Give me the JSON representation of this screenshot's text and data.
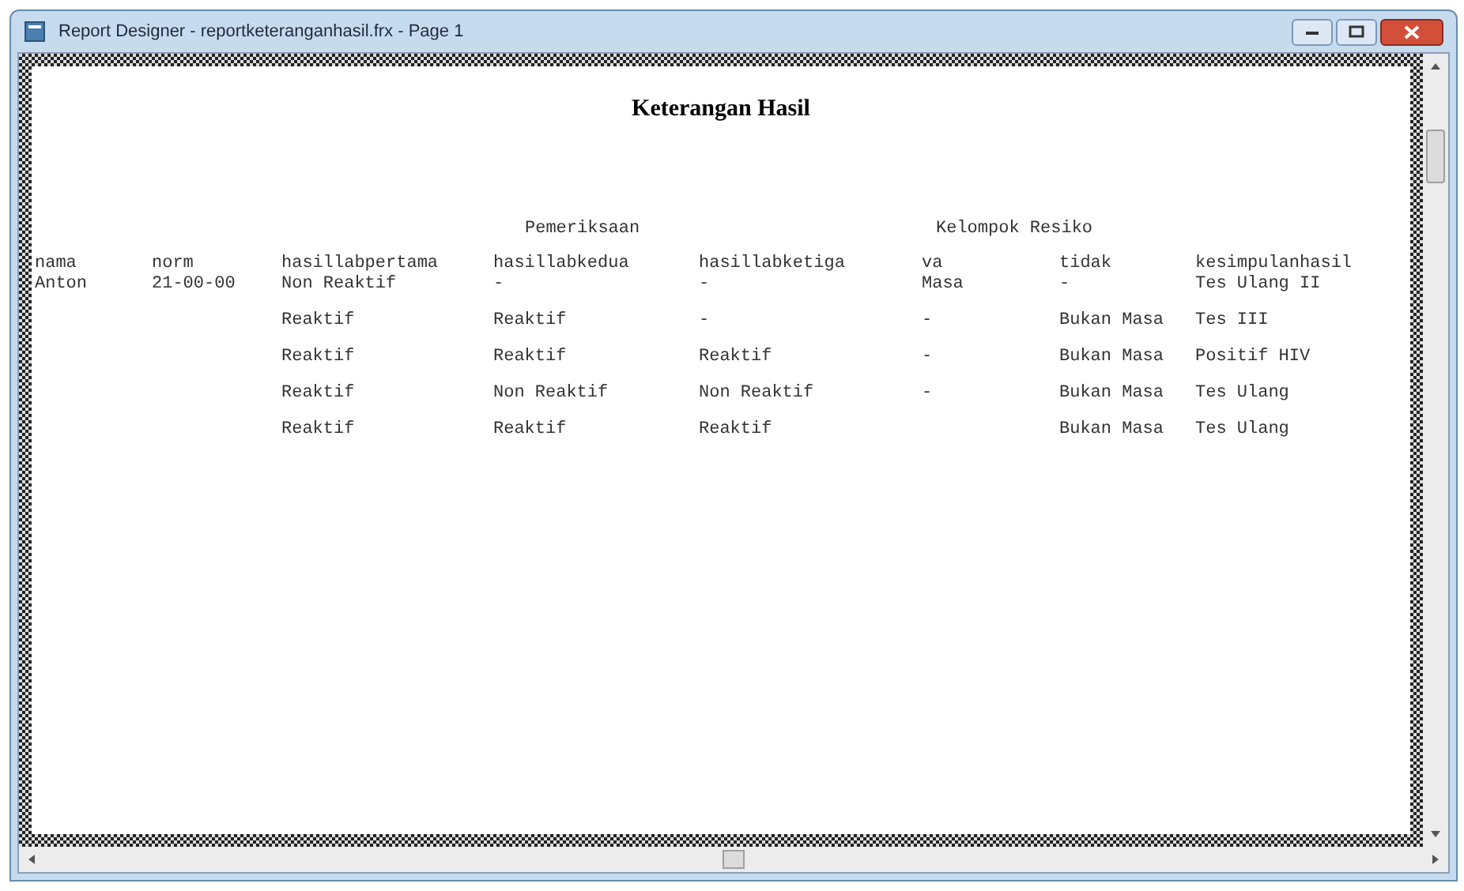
{
  "window": {
    "title": "Report Designer - reportketeranganhasil.frx - Page 1"
  },
  "report": {
    "title": "Keterangan Hasil",
    "group_headers": [
      {
        "label": "Pemeriksaan"
      },
      {
        "label": "Kelompok Resiko"
      }
    ],
    "columns": [
      "nama",
      "norm",
      "hasillabpertama",
      "hasillabkedua",
      "hasillabketiga",
      "va",
      "tidak",
      "kesimpulanhasil"
    ],
    "rows": [
      [
        "Anton",
        "21-00-00",
        "Non Reaktif",
        "-",
        "-",
        "Masa",
        "-",
        "Tes Ulang II"
      ],
      [
        null,
        null,
        "Reaktif",
        "Reaktif",
        "-",
        "-",
        "Bukan Masa",
        "Tes III"
      ],
      [
        null,
        null,
        "Reaktif",
        "Reaktif",
        "Reaktif",
        "-",
        "Bukan Masa",
        "Positif HIV"
      ],
      [
        null,
        null,
        "Reaktif",
        "Non Reaktif",
        "Non Reaktif",
        "-",
        "Bukan Masa",
        "Tes Ulang"
      ],
      [
        null,
        null,
        "Reaktif",
        "Reaktif",
        "Reaktif",
        null,
        "Bukan Masa",
        "Tes Ulang"
      ]
    ]
  }
}
